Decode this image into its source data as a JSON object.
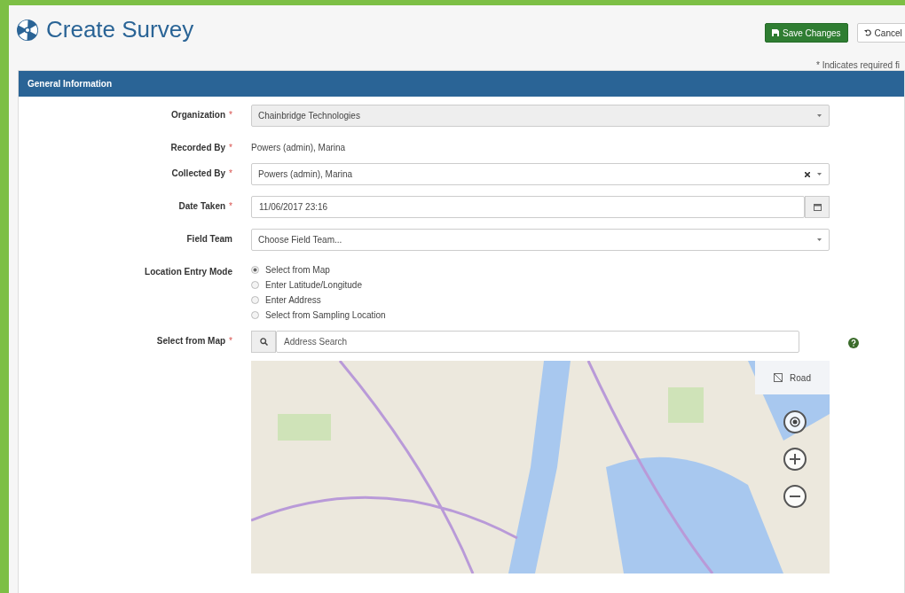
{
  "header": {
    "title": "Create Survey",
    "actions": [
      {
        "label": "Save Changes",
        "kind": "primary"
      },
      {
        "label": "Cancel",
        "kind": "default"
      }
    ],
    "required_note": "* Indicates required fi"
  },
  "panel": {
    "title": "General Information",
    "fields": [
      {
        "label": "Organization",
        "required_mark": "*",
        "kind": "select",
        "value": "Chainbridge Technologies",
        "disabled": true
      },
      {
        "label": "Recorded By",
        "required_mark": "*",
        "kind": "static",
        "value": "Powers (admin), Marina"
      },
      {
        "label": "Collected By",
        "required_mark": "*",
        "kind": "select",
        "value": "Powers (admin), Marina",
        "clearable": true
      },
      {
        "label": "Date Taken",
        "required_mark": "*",
        "kind": "date",
        "value": "11/06/2017 23:16"
      },
      {
        "label": "Field Team",
        "kind": "select",
        "placeholder": "Choose Field Team..."
      },
      {
        "label": "Location Entry Mode",
        "kind": "radio",
        "options": [
          {
            "label": "Select from Map",
            "selected": true
          },
          {
            "label": "Enter Latitude/Longitude",
            "selected": false
          },
          {
            "label": "Enter Address",
            "selected": false
          },
          {
            "label": "Select from Sampling Location",
            "selected": false
          }
        ]
      },
      {
        "label": "Select from Map",
        "required_mark": "*",
        "kind": "map",
        "placeholder": "Address Search",
        "map_style": "Road"
      }
    ]
  }
}
